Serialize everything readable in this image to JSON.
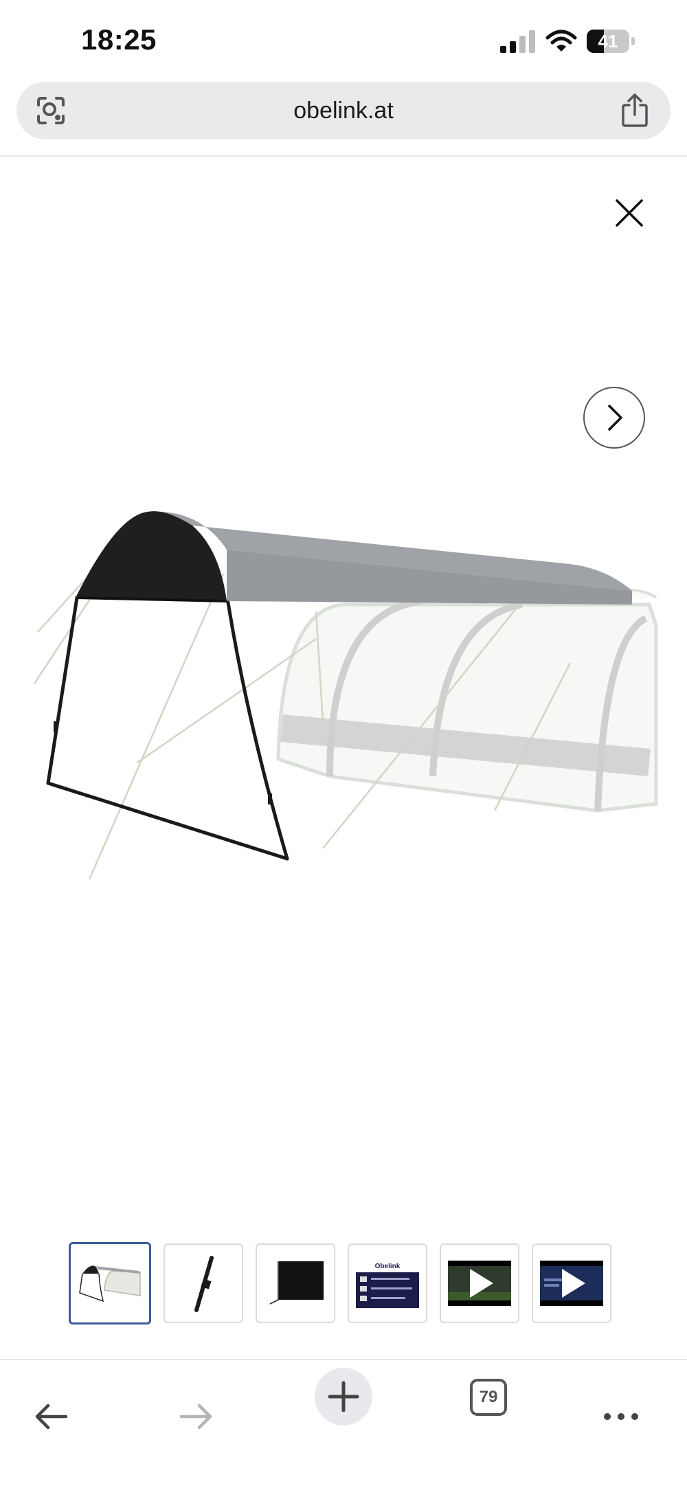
{
  "status_bar": {
    "time": "18:25",
    "battery_percent": 41,
    "battery_label": "41"
  },
  "browser": {
    "url": "obelink.at",
    "open_tabs": "79"
  },
  "thumbnails": [
    {
      "kind": "tent-overview",
      "selected": true
    },
    {
      "kind": "pole-detail",
      "selected": false
    },
    {
      "kind": "side-wall",
      "selected": false
    },
    {
      "kind": "infographic",
      "selected": false,
      "logo_text": "Obelink"
    },
    {
      "kind": "video",
      "selected": false
    },
    {
      "kind": "video",
      "selected": false
    }
  ],
  "colors": {
    "canopy_dark": "#1f1f1f",
    "canopy_grey": "#9fa3a7",
    "selected_thumb_border": "#3b5b98",
    "url_bar_bg": "#e8eaec"
  }
}
